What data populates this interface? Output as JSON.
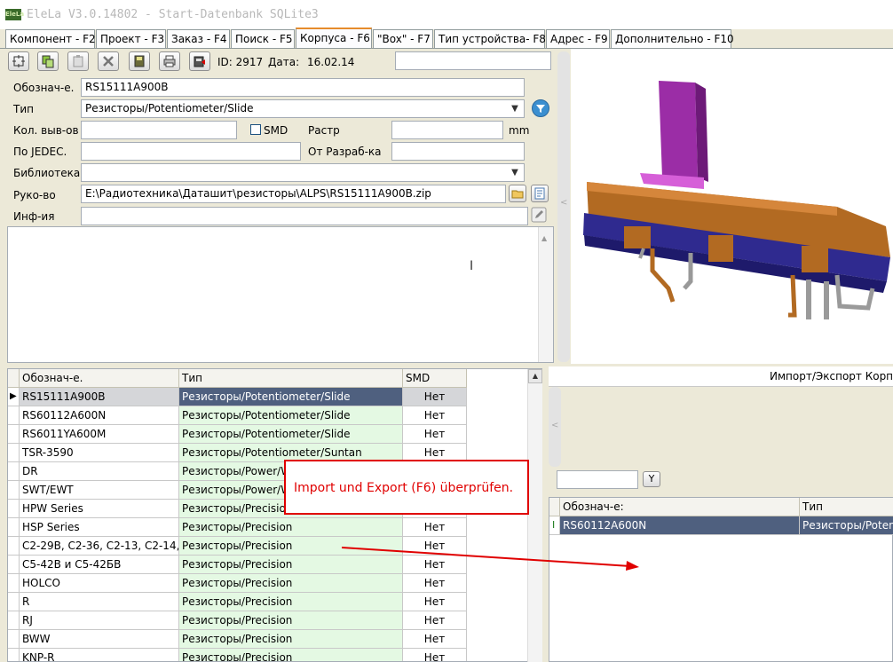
{
  "window": {
    "title": "EleLa V3.0.14802 - Start-Datenbank SQLite3",
    "logo_text": "EleLa"
  },
  "tabs": [
    {
      "label": "Компонент - F2"
    },
    {
      "label": "Проект - F3"
    },
    {
      "label": "Заказ - F4"
    },
    {
      "label": "Поиск - F5"
    },
    {
      "label": "Корпуса - F6",
      "active": true
    },
    {
      "label": "\"Box\" - F7"
    },
    {
      "label": "Тип устройства- F8"
    },
    {
      "label": "Адрес - F9"
    },
    {
      "label": "Дополнительно - F10"
    }
  ],
  "toolbar": {
    "id_label": "ID: 2917",
    "date_label": "Дата:",
    "date_value": "16.02.14",
    "buttons": [
      "new-icon",
      "copy-icon",
      "paste-icon",
      "delete-icon",
      "save-icon",
      "print-icon",
      "export-icon"
    ],
    "search_value": ""
  },
  "form": {
    "designation_label": "Обознач-е.",
    "designation_value": "RS15111A900B",
    "type_label": "Тип",
    "type_value": "Резисторы/Potentiometer/Slide",
    "pins_label": "Кол. выв-ов",
    "pins_value": "",
    "smd_label": "SMD",
    "smd_checked": false,
    "pitch_label": "Растр",
    "pitch_value": "",
    "pitch_unit": "mm",
    "jedec_label": "По JEDEC.",
    "jedec_value": "",
    "developer_label": "От Разраб-ка",
    "developer_value": "",
    "library_label": "Библиотека",
    "library_value": "",
    "manual_label": "Руко-во",
    "manual_value": "E:\\Радиотехника\\Даташит\\резисторы\\ALPS\\RS15111A900B.zip",
    "info_label": "Инф-ия",
    "info_value": "",
    "notes": ""
  },
  "grid": {
    "columns": [
      "Обознач-е.",
      "Тип",
      "SMD"
    ],
    "rows": [
      {
        "name": "RS15111A900B",
        "type": "Резисторы/Potentiometer/Slide",
        "smd": "Нет",
        "selected": true
      },
      {
        "name": "RS60112A600N",
        "type": "Резисторы/Potentiometer/Slide",
        "smd": "Нет"
      },
      {
        "name": "RS6011YA600M",
        "type": "Резисторы/Potentiometer/Slide",
        "smd": "Нет"
      },
      {
        "name": "TSR-3590",
        "type": "Резисторы/Potentiometer/Suntan",
        "smd": "Нет"
      },
      {
        "name": "DR",
        "type": "Резисторы/Power/W",
        "smd": "Нет"
      },
      {
        "name": "SWT/EWT",
        "type": "Резисторы/Power/W",
        "smd": "Нет"
      },
      {
        "name": "HPW Series",
        "type": "Резисторы/Precision",
        "smd": "Нет"
      },
      {
        "name": "HSP Series",
        "type": "Резисторы/Precision",
        "smd": "Нет"
      },
      {
        "name": "C2-29B, C2-36, C2-13, C2-14,",
        "type": "Резисторы/Precision",
        "smd": "Нет"
      },
      {
        "name": "C5-42B и C5-42БВ",
        "type": "Резисторы/Precision",
        "smd": "Нет"
      },
      {
        "name": "HOLCO",
        "type": "Резисторы/Precision",
        "smd": "Нет"
      },
      {
        "name": "R",
        "type": "Резисторы/Precision",
        "smd": "Нет"
      },
      {
        "name": "RJ",
        "type": "Резисторы/Precision",
        "smd": "Нет"
      },
      {
        "name": "BWW",
        "type": "Резисторы/Precision",
        "smd": "Нет"
      },
      {
        "name": "KNP-R",
        "type": "Резисторы/Precision",
        "smd": "Нет"
      }
    ]
  },
  "import_panel": {
    "title": "Импорт/Экспорт Корпус",
    "filter_value": "",
    "filter_button": "Y",
    "columns": [
      "Обознач-е:",
      "Тип"
    ],
    "rows": [
      {
        "name": "RS60112A600N",
        "type": "Резисторы/Potent"
      }
    ]
  },
  "annotation": {
    "text": "Import und Export (F6) überprüfen.",
    "color": "#e00000"
  },
  "colors": {
    "selected_row": "#4f607f",
    "type_cell": "#e4f9e3",
    "active_tab": "#e68b2c"
  }
}
